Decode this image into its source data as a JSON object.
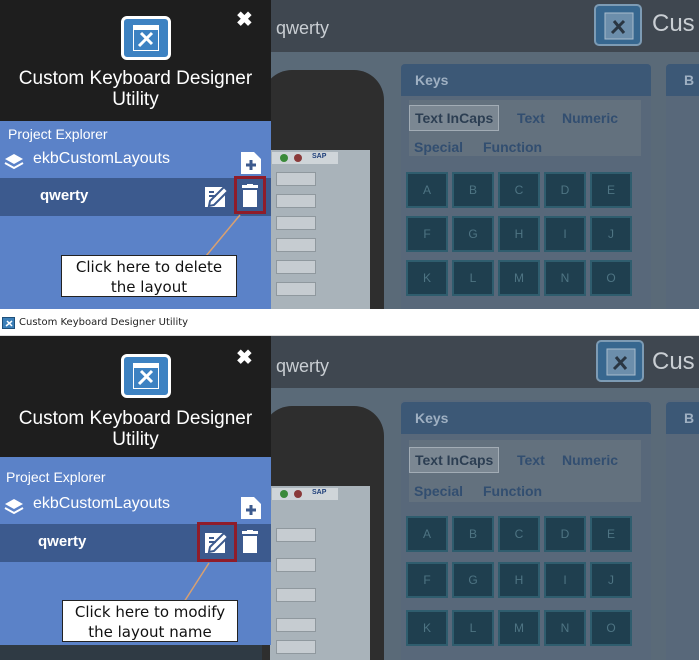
{
  "menu": {
    "app_title_line1": "Custom Keyboard Designer",
    "app_title_line2": "Utility",
    "close_glyph": "✖",
    "project_explorer_label": "Project Explorer",
    "project_name": "ekbCustomLayouts",
    "layout_name": "qwerty"
  },
  "app": {
    "layout_title": "qwerty",
    "logo_text": "Cus",
    "keys_header": "Keys",
    "b_header": "B",
    "tabs": [
      "Text InCaps",
      "Text",
      "Numeric",
      "Special",
      "Function"
    ],
    "keys_row1": [
      "A",
      "B",
      "C",
      "D",
      "E"
    ],
    "keys_row2": [
      "F",
      "G",
      "H",
      "I",
      "J"
    ],
    "keys_row3": [
      "K",
      "L",
      "M",
      "N",
      "O"
    ],
    "device_brand": "SAP"
  },
  "window": {
    "title": "Custom Keyboard Designer Utility"
  },
  "callouts": {
    "delete_line1": "Click here to delete",
    "delete_line2": "the layout",
    "modify_line1": "Click here to modify",
    "modify_line2": "the layout name"
  },
  "colors": {
    "menu_top": "#1e1e1e",
    "menu_body": "#5b82c8",
    "layout_row": "#3c5a8e",
    "highlight": "#8f1c2a",
    "arrow": "#d9a070"
  },
  "icons": {
    "app_logo": "tools-window-icon",
    "close": "close-icon",
    "project": "layers-icon",
    "add": "add-layout-icon",
    "edit": "edit-icon",
    "delete": "trash-icon"
  }
}
